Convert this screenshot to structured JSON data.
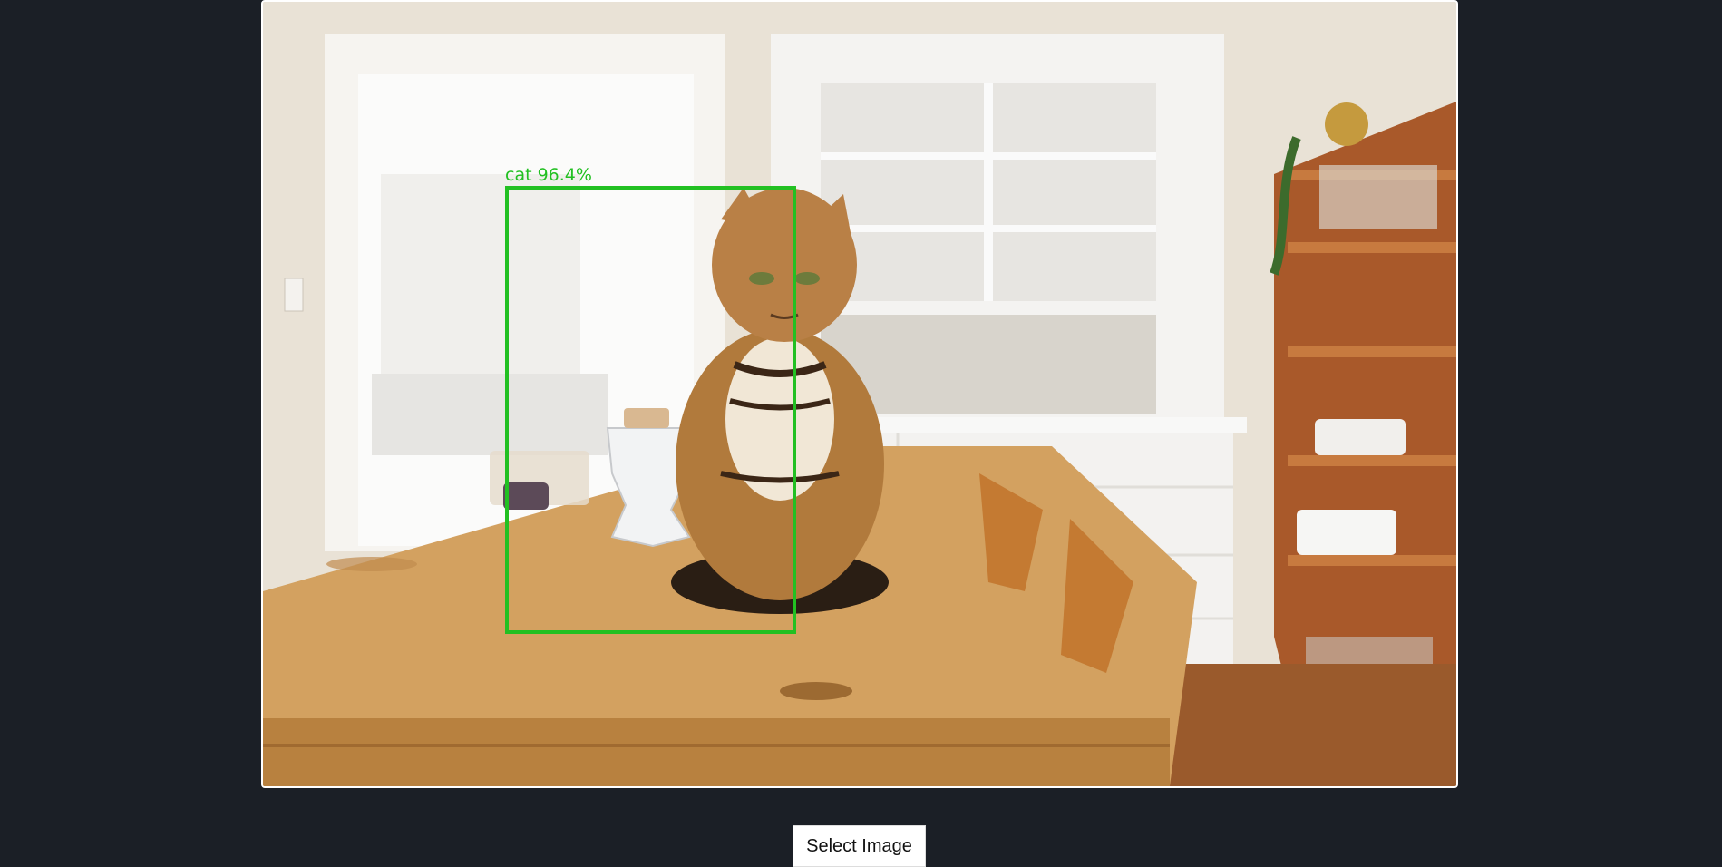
{
  "detection": {
    "label": "cat 96.4%",
    "class": "cat",
    "confidence": 96.4
  },
  "controls": {
    "select_label": "Select Image"
  },
  "colors": {
    "background": "#1b1f26",
    "bbox": "#22c022",
    "frame": "#ffffff"
  },
  "image": {
    "subject": "cat-sitting-on-kitchen-table-photo"
  }
}
